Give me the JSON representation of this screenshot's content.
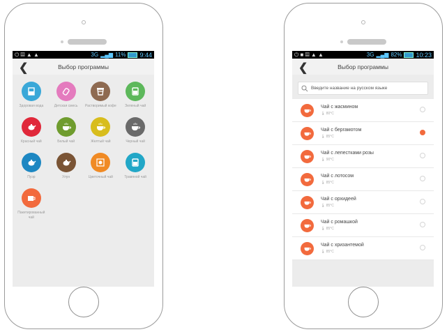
{
  "left": {
    "status": {
      "icons": "⏻ ▤ ▲ ▲",
      "net": "3G",
      "battery": "11%",
      "time": "9:44"
    },
    "title": "Выбор программы",
    "programs": [
      {
        "name": "Здоровая вода",
        "color": "#3aa8d8",
        "icon": "glass-icon"
      },
      {
        "name": "Детская смесь",
        "color": "#e47bbe",
        "icon": "baby-bottle-icon"
      },
      {
        "name": "Растворимый кофе",
        "color": "#8e6a51",
        "icon": "coffee-cup-icon"
      },
      {
        "name": "Зеленый чай",
        "color": "#5db85b",
        "icon": "tea-glass-icon"
      },
      {
        "name": "Красный чай",
        "color": "#e0283a",
        "icon": "teapot-icon"
      },
      {
        "name": "Белый чай",
        "color": "#6f9c2e",
        "icon": "tea-cup-icon"
      },
      {
        "name": "Желтый чай",
        "color": "#d8bd1d",
        "icon": "tea-cup-icon"
      },
      {
        "name": "Черный чай",
        "color": "#6a6a6a",
        "icon": "tea-cup-icon"
      },
      {
        "name": "Пуэр",
        "color": "#1d87c2",
        "icon": "teapot-icon"
      },
      {
        "name": "Улун",
        "color": "#7a5435",
        "icon": "teapot-icon"
      },
      {
        "name": "Цветочный чай",
        "color": "#f08a24",
        "icon": "flower-cup-icon"
      },
      {
        "name": "Травяной чай",
        "color": "#22a7c7",
        "icon": "tea-glass-icon"
      },
      {
        "name": "Пакетированный чай",
        "color": "#f26a3d",
        "icon": "tea-bag-icon"
      }
    ]
  },
  "right": {
    "status": {
      "icons": "⏻ ■ ▤ ▲ ▲",
      "net": "3G",
      "battery": "82%",
      "time": "10:23"
    },
    "title": "Выбор программы",
    "search_placeholder": "Введите название на русском языке",
    "teas": [
      {
        "name": "Чай с жасмином",
        "temp": "80°C",
        "selected": false
      },
      {
        "name": "Чай с бергамотом",
        "temp": "85°C",
        "selected": true
      },
      {
        "name": "Чай с лепестками розы",
        "temp": "90°C",
        "selected": false
      },
      {
        "name": "Чай с лотосом",
        "temp": "85°C",
        "selected": false
      },
      {
        "name": "Чай с орхидеей",
        "temp": "85°C",
        "selected": false
      },
      {
        "name": "Чай с ромашкой",
        "temp": "85°C",
        "selected": false
      },
      {
        "name": "Чай с хризантемой",
        "temp": "85°C",
        "selected": false
      }
    ],
    "accent": "#f26a3d"
  }
}
